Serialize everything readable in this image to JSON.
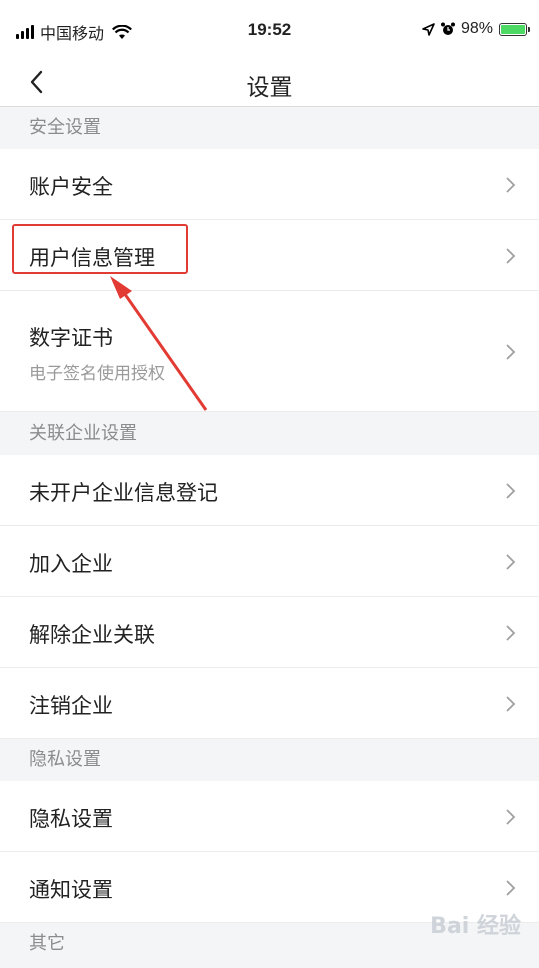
{
  "status": {
    "carrier": "中国移动",
    "time": "19:52",
    "battery": "98%",
    "battery_level": 98
  },
  "nav": {
    "title": "设置"
  },
  "sections": [
    {
      "header": "安全设置"
    },
    {
      "header": "关联企业设置"
    },
    {
      "header": "隐私设置"
    },
    {
      "header": "其它"
    }
  ],
  "rows": {
    "account_security": "账户安全",
    "user_info": "用户信息管理",
    "digital_cert": "数字证书",
    "digital_cert_sub": "电子签名使用授权",
    "unregistered_info": "未开户企业信息登记",
    "join_company": "加入企业",
    "unlink_company": "解除企业关联",
    "cancel_company": "注销企业",
    "privacy": "隐私设置",
    "notification": "通知设置"
  },
  "watermark": "Bai 经验",
  "colors": {
    "highlight": "#e23b34",
    "battery": "#4cd964"
  }
}
